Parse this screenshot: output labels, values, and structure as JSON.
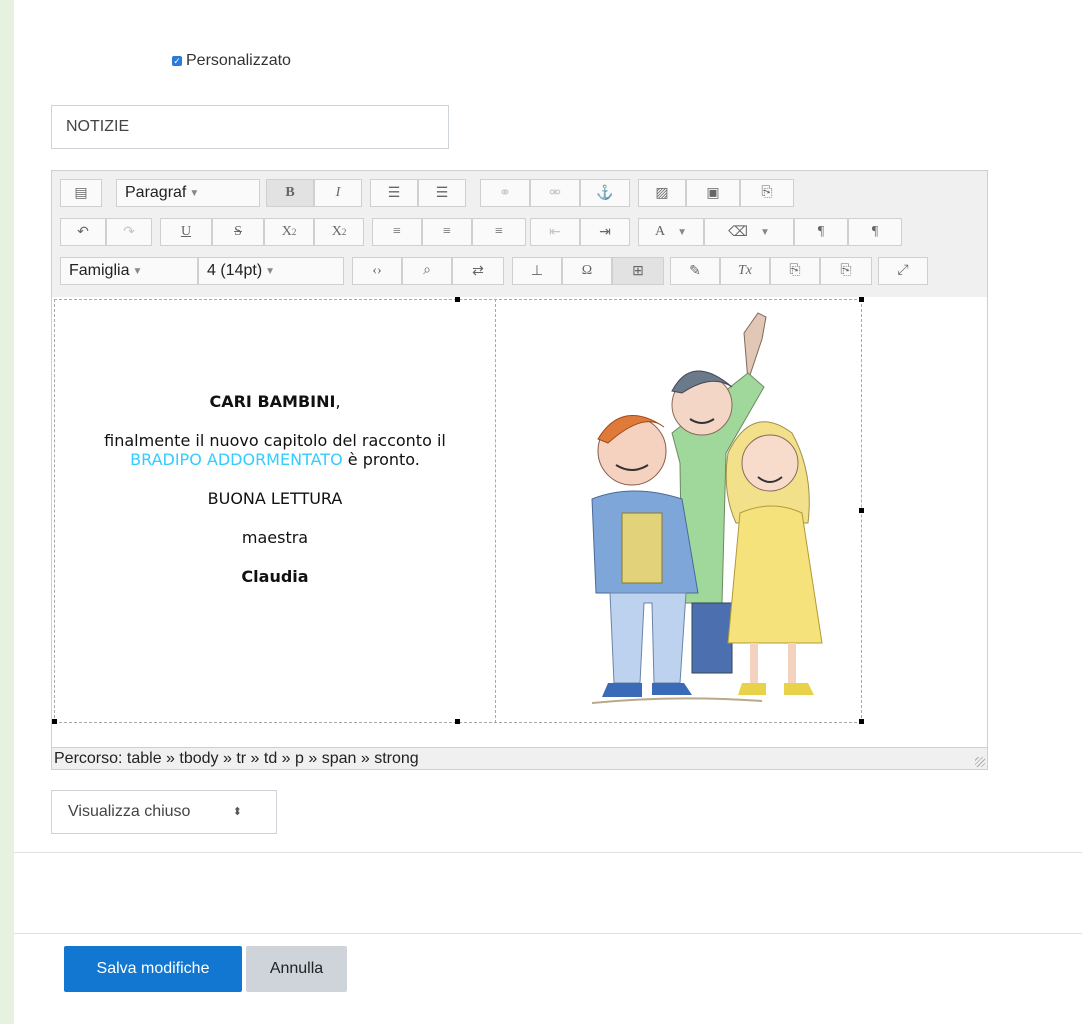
{
  "custom_checkbox": {
    "label": "Personalizzato",
    "checked": true
  },
  "title_field": {
    "value": "NOTIZIE"
  },
  "editor": {
    "toolbar": {
      "paragraph_select": "Paragraf",
      "font_family_select": "Famiglia",
      "font_size_select": "4 (14pt)"
    },
    "content": {
      "greeting": "CARI BAMBINI",
      "greeting_punct": ",",
      "line1": "finalmente il nuovo capitolo del racconto il",
      "highlight": "BRADIPO ADDORMENTATO",
      "line2_rest": " è pronto.",
      "wish": "BUONA LETTURA",
      "role": "maestra",
      "name": "Claudia",
      "highlight_color": "#33ccff"
    },
    "status_path": "Percorso: table » tbody » tr » td » p » span » strong"
  },
  "visibility_select": {
    "value": "Visualizza chiuso"
  },
  "buttons": {
    "save": "Salva modifiche",
    "cancel": "Annulla"
  },
  "colors": {
    "primary": "#1177d1",
    "secondary": "#ced4da",
    "page_bg": "#e6f2df"
  }
}
